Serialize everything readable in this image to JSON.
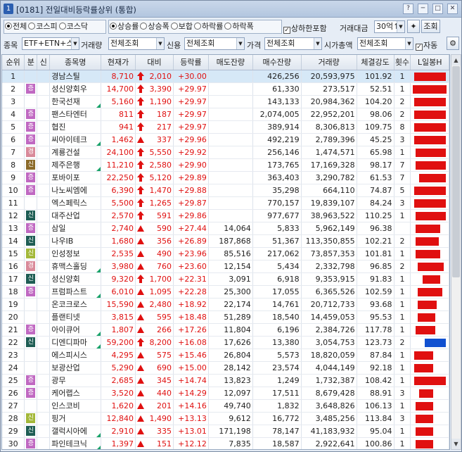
{
  "window": {
    "screen_num": "1",
    "title": "[0181] 전일대비등락률상위 (통합)",
    "btns": [
      "?",
      "─",
      "□",
      "✕"
    ]
  },
  "market_filter": {
    "options": [
      "전체",
      "코스피",
      "코스닥"
    ],
    "selected": 0
  },
  "sort_filter": {
    "options": [
      "상승률",
      "상승폭",
      "보합",
      "하락률",
      "하락폭"
    ],
    "selected": 0
  },
  "include_limit": {
    "label": "상하한포함",
    "checked": true
  },
  "trade_amount": {
    "label": "거래대금",
    "value": "30억↑"
  },
  "query_button": "조회",
  "filters": {
    "jongmok_label": "종목",
    "jongmok_value": "ETF+ETN+스1",
    "volume_label": "거래량",
    "volume_value": "전체조회",
    "credit_label": "신용",
    "credit_value": "전체조회",
    "price_label": "가격",
    "price_value": "전체조회",
    "cap_label": "시가총액",
    "cap_value": "전체조회",
    "auto_label": "자동",
    "auto_checked": true
  },
  "columns": [
    "순위",
    "분",
    "신",
    "종목명",
    "현재가",
    "대비",
    "등락률",
    "매도잔량",
    "매수잔량",
    "거래량",
    "체결강도",
    "횟수",
    "L일봉H"
  ],
  "colors": {
    "up": "#e01010",
    "selected_row": "#d6e8f7",
    "candle_up": "#e01010",
    "candle_down": "#1050d0"
  },
  "rows": [
    {
      "rank": "1",
      "bun": "",
      "bun_type": "",
      "sin": "",
      "name": "경남스틸",
      "price": "8,710",
      "diff": "2,010",
      "rate": "+30.00",
      "ask": "",
      "bid": "426,256",
      "vol": "20,593,975",
      "strength": "101.92",
      "count": "1",
      "arrow": "up",
      "sel": true,
      "tri": false,
      "ind": [
        0.05,
        0.95
      ]
    },
    {
      "rank": "2",
      "bun": "증",
      "bun_type": "zeung",
      "sin": "",
      "name": "성신양회우",
      "price": "14,700",
      "diff": "3,390",
      "rate": "+29.97",
      "ask": "",
      "bid": "61,330",
      "vol": "273,517",
      "strength": "52.51",
      "count": "1",
      "arrow": "up",
      "sel": false,
      "tri": false,
      "ind": [
        0.02,
        0.97
      ]
    },
    {
      "rank": "3",
      "bun": "",
      "bun_type": "",
      "sin": "",
      "name": "한국선재",
      "price": "5,160",
      "diff": "1,190",
      "rate": "+29.97",
      "ask": "",
      "bid": "143,133",
      "vol": "20,984,362",
      "strength": "104.20",
      "count": "2",
      "arrow": "up",
      "sel": false,
      "tri": true,
      "ind": [
        0.05,
        0.95
      ]
    },
    {
      "rank": "4",
      "bun": "증",
      "bun_type": "zeung",
      "sin": "",
      "name": "팬스타엔터",
      "price": "811",
      "diff": "187",
      "rate": "+29.97",
      "ask": "",
      "bid": "2,074,005",
      "vol": "22,952,201",
      "strength": "98.06",
      "count": "2",
      "arrow": "up",
      "sel": false,
      "tri": false,
      "ind": [
        0.05,
        0.95
      ]
    },
    {
      "rank": "5",
      "bun": "증",
      "bun_type": "zeung",
      "sin": "",
      "name": "협진",
      "price": "941",
      "diff": "217",
      "rate": "+29.97",
      "ask": "",
      "bid": "389,914",
      "vol": "8,306,813",
      "strength": "109.75",
      "count": "8",
      "arrow": "up",
      "sel": false,
      "tri": false,
      "ind": [
        0.05,
        0.95
      ]
    },
    {
      "rank": "6",
      "bun": "증",
      "bun_type": "zeung",
      "sin": "",
      "name": "씨아이테크",
      "price": "1,462",
      "diff": "337",
      "rate": "+29.96",
      "ask": "",
      "bid": "492,219",
      "vol": "2,789,396",
      "strength": "45.25",
      "count": "3",
      "arrow": "tri",
      "sel": false,
      "tri": true,
      "ind": [
        0.05,
        0.95
      ]
    },
    {
      "rank": "7",
      "bun": "경",
      "bun_type": "gyeong",
      "sin": "",
      "name": "계룡건설",
      "price": "24,100",
      "diff": "5,550",
      "rate": "+29.92",
      "ask": "",
      "bid": "256,146",
      "vol": "1,474,571",
      "strength": "65.98",
      "count": "1",
      "arrow": "up",
      "sel": false,
      "tri": false,
      "ind": [
        0.1,
        0.95
      ]
    },
    {
      "rank": "8",
      "bun": "신",
      "bun_type": "sin3",
      "sin": "",
      "name": "제주은행",
      "price": "11,210",
      "diff": "2,580",
      "rate": "+29.90",
      "ask": "",
      "bid": "173,765",
      "vol": "17,169,328",
      "strength": "98.17",
      "count": "7",
      "arrow": "up",
      "sel": false,
      "tri": true,
      "ind": [
        0.1,
        0.95
      ]
    },
    {
      "rank": "9",
      "bun": "증",
      "bun_type": "zeung",
      "sin": "",
      "name": "포바이포",
      "price": "22,250",
      "diff": "5,120",
      "rate": "+29.89",
      "ask": "",
      "bid": "363,403",
      "vol": "3,290,782",
      "strength": "61.53",
      "count": "7",
      "arrow": "up",
      "sel": false,
      "tri": false,
      "ind": [
        0.2,
        0.95
      ]
    },
    {
      "rank": "10",
      "bun": "증",
      "bun_type": "zeung",
      "sin": "",
      "name": "나노씨엠에",
      "price": "6,390",
      "diff": "1,470",
      "rate": "+29.88",
      "ask": "",
      "bid": "35,298",
      "vol": "664,110",
      "strength": "74.87",
      "count": "5",
      "arrow": "up",
      "sel": false,
      "tri": false,
      "ind": [
        0.05,
        0.95
      ]
    },
    {
      "rank": "11",
      "bun": "",
      "bun_type": "",
      "sin": "",
      "name": "엑스페릭스",
      "price": "5,500",
      "diff": "1,265",
      "rate": "+29.87",
      "ask": "",
      "bid": "770,157",
      "vol": "19,839,107",
      "strength": "84.24",
      "count": "3",
      "arrow": "up",
      "sel": false,
      "tri": false,
      "ind": [
        0.05,
        0.95
      ]
    },
    {
      "rank": "12",
      "bun": "신",
      "bun_type": "sin",
      "sin": "",
      "name": "대주산업",
      "price": "2,570",
      "diff": "591",
      "rate": "+29.86",
      "ask": "",
      "bid": "977,677",
      "vol": "38,963,522",
      "strength": "110.25",
      "count": "1",
      "arrow": "up",
      "sel": false,
      "tri": false,
      "ind": [
        0.1,
        0.95
      ]
    },
    {
      "rank": "13",
      "bun": "증",
      "bun_type": "zeung",
      "sin": "",
      "name": "삼일",
      "price": "2,740",
      "diff": "590",
      "rate": "+27.44",
      "ask": "14,064",
      "bid": "5,833",
      "vol": "5,962,149",
      "strength": "96.38",
      "count": "",
      "arrow": "tri",
      "sel": false,
      "tri": false,
      "ind": [
        0.1,
        0.8
      ]
    },
    {
      "rank": "14",
      "bun": "신",
      "bun_type": "sin",
      "sin": "",
      "name": "나우IB",
      "price": "1,680",
      "diff": "356",
      "rate": "+26.89",
      "ask": "187,868",
      "bid": "51,367",
      "vol": "113,350,855",
      "strength": "102.21",
      "count": "2",
      "arrow": "tri",
      "sel": false,
      "tri": false,
      "ind": [
        0.1,
        0.75
      ]
    },
    {
      "rank": "15",
      "bun": "신",
      "bun_type": "sin2",
      "sin": "",
      "name": "인성정보",
      "price": "2,535",
      "diff": "490",
      "rate": "+23.96",
      "ask": "85,516",
      "bid": "217,062",
      "vol": "73,857,353",
      "strength": "101.81",
      "count": "1",
      "arrow": "tri",
      "sel": false,
      "tri": false,
      "ind": [
        0.1,
        0.8
      ]
    },
    {
      "rank": "16",
      "bun": "경",
      "bun_type": "gyeong",
      "sin": "",
      "name": "휴맥스홀딩",
      "price": "3,980",
      "diff": "760",
      "rate": "+23.60",
      "ask": "12,154",
      "bid": "5,434",
      "vol": "2,332,798",
      "strength": "96.85",
      "count": "2",
      "arrow": "tri",
      "sel": false,
      "tri": true,
      "ind": [
        0.15,
        0.9
      ]
    },
    {
      "rank": "17",
      "bun": "신",
      "bun_type": "sin",
      "sin": "",
      "name": "성신양회",
      "price": "9,320",
      "diff": "1,700",
      "rate": "+22.31",
      "ask": "3,091",
      "bid": "6,918",
      "vol": "9,353,915",
      "strength": "91.83",
      "count": "1",
      "arrow": "up",
      "sel": false,
      "tri": false,
      "ind": [
        0.3,
        0.8
      ]
    },
    {
      "rank": "18",
      "bun": "증",
      "bun_type": "zeung",
      "sin": "",
      "name": "프럼파스트",
      "price": "6,010",
      "diff": "1,095",
      "rate": "+22.28",
      "ask": "25,300",
      "bid": "17,055",
      "vol": "6,365,526",
      "strength": "102.59",
      "count": "1",
      "arrow": "tri",
      "sel": false,
      "tri": true,
      "ind": [
        0.15,
        0.85
      ]
    },
    {
      "rank": "19",
      "bun": "",
      "bun_type": "",
      "sin": "",
      "name": "온코크로스",
      "price": "15,590",
      "diff": "2,480",
      "rate": "+18.92",
      "ask": "22,174",
      "bid": "14,761",
      "vol": "20,712,733",
      "strength": "93.68",
      "count": "1",
      "arrow": "tri",
      "sel": false,
      "tri": false,
      "ind": [
        0.15,
        0.7
      ]
    },
    {
      "rank": "20",
      "bun": "",
      "bun_type": "",
      "sin": "",
      "name": "플랜티넷",
      "price": "3,815",
      "diff": "595",
      "rate": "+18.48",
      "ask": "51,289",
      "bid": "18,540",
      "vol": "14,459,053",
      "strength": "95.53",
      "count": "1",
      "arrow": "tri",
      "sel": false,
      "tri": false,
      "ind": [
        0.15,
        0.65
      ]
    },
    {
      "rank": "21",
      "bun": "증",
      "bun_type": "zeung",
      "sin": "",
      "name": "아이큐어",
      "price": "1,807",
      "diff": "266",
      "rate": "+17.26",
      "ask": "11,804",
      "bid": "6,196",
      "vol": "2,384,726",
      "strength": "117.78",
      "count": "1",
      "arrow": "tri",
      "sel": false,
      "tri": true,
      "ind": [
        0.1,
        0.65
      ]
    },
    {
      "rank": "22",
      "bun": "신",
      "bun_type": "sin",
      "sin": "",
      "name": "디엔디파마",
      "price": "59,200",
      "diff": "8,200",
      "rate": "+16.08",
      "ask": "17,626",
      "bid": "13,380",
      "vol": "3,054,753",
      "strength": "123.73",
      "count": "2",
      "arrow": "up",
      "sel": false,
      "tri": true,
      "ind": [
        0.35,
        0.95
      ],
      "down": true
    },
    {
      "rank": "23",
      "bun": "",
      "bun_type": "",
      "sin": "",
      "name": "에스피시스",
      "price": "4,295",
      "diff": "575",
      "rate": "+15.46",
      "ask": "26,804",
      "bid": "5,573",
      "vol": "18,820,059",
      "strength": "87.84",
      "count": "1",
      "arrow": "tri",
      "sel": false,
      "tri": false,
      "ind": [
        0.05,
        0.6
      ]
    },
    {
      "rank": "24",
      "bun": "",
      "bun_type": "",
      "sin": "",
      "name": "보광산업",
      "price": "5,290",
      "diff": "690",
      "rate": "+15.00",
      "ask": "28,142",
      "bid": "23,574",
      "vol": "4,044,149",
      "strength": "92.18",
      "count": "1",
      "arrow": "tri",
      "sel": false,
      "tri": false,
      "ind": [
        0.05,
        0.6
      ]
    },
    {
      "rank": "25",
      "bun": "증",
      "bun_type": "zeung",
      "sin": "",
      "name": "광무",
      "price": "2,685",
      "diff": "345",
      "rate": "+14.74",
      "ask": "13,823",
      "bid": "1,249",
      "vol": "1,732,387",
      "strength": "108.42",
      "count": "1",
      "arrow": "tri",
      "sel": false,
      "tri": false,
      "ind": [
        0.05,
        0.95
      ]
    },
    {
      "rank": "26",
      "bun": "증",
      "bun_type": "zeung",
      "sin": "",
      "name": "케어랩스",
      "price": "3,520",
      "diff": "440",
      "rate": "+14.29",
      "ask": "12,097",
      "bid": "17,511",
      "vol": "8,679,428",
      "strength": "88.91",
      "count": "3",
      "arrow": "tri",
      "sel": false,
      "tri": false,
      "ind": [
        0.2,
        0.6
      ]
    },
    {
      "rank": "27",
      "bun": "",
      "bun_type": "",
      "sin": "",
      "name": "인스코비",
      "price": "1,620",
      "diff": "201",
      "rate": "+14.16",
      "ask": "49,740",
      "bid": "1,832",
      "vol": "3,648,826",
      "strength": "106.13",
      "count": "1",
      "arrow": "tri",
      "sel": false,
      "tri": false,
      "ind": [
        0.1,
        0.6
      ]
    },
    {
      "rank": "28",
      "bun": "신",
      "bun_type": "sin2",
      "sin": "",
      "name": "핑거",
      "price": "12,840",
      "diff": "1,490",
      "rate": "+13.13",
      "ask": "9,612",
      "bid": "16,772",
      "vol": "3,485,256",
      "strength": "113.84",
      "count": "3",
      "arrow": "tri",
      "sel": false,
      "tri": false,
      "ind": [
        0.1,
        0.6
      ]
    },
    {
      "rank": "29",
      "bun": "신",
      "bun_type": "sin",
      "sin": "",
      "name": "갤럭시아에",
      "price": "2,910",
      "diff": "335",
      "rate": "+13.01",
      "ask": "171,198",
      "bid": "78,147",
      "vol": "41,183,932",
      "strength": "95.04",
      "count": "1",
      "arrow": "tri",
      "sel": false,
      "tri": true,
      "ind": [
        0.1,
        0.6
      ]
    },
    {
      "rank": "30",
      "bun": "증",
      "bun_type": "zeung",
      "sin": "",
      "name": "파인테크닉",
      "price": "1,397",
      "diff": "151",
      "rate": "+12.12",
      "ask": "7,835",
      "bid": "18,587",
      "vol": "2,922,641",
      "strength": "100.86",
      "count": "1",
      "arrow": "tri",
      "sel": false,
      "tri": true,
      "ind": [
        0.1,
        0.6
      ]
    }
  ]
}
